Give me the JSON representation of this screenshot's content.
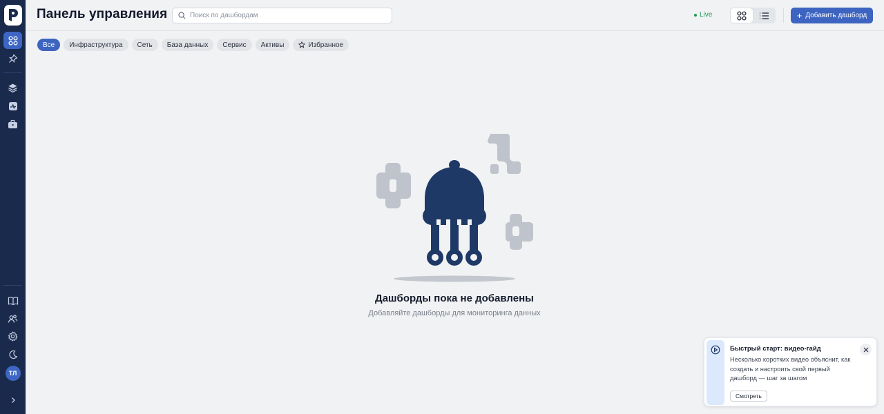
{
  "header": {
    "title": "Панель управления",
    "search_placeholder": "Поиск по дашбордам",
    "live_label": "Live",
    "add_button_label": "Добавить дашборд"
  },
  "sidebar": {
    "logo_icon": "logo-icon",
    "top_items": [
      {
        "icon": "grid-icon",
        "active": true
      },
      {
        "icon": "pin-icon",
        "active": false
      }
    ],
    "middle_items": [
      {
        "icon": "layers-icon"
      },
      {
        "icon": "activity-icon"
      },
      {
        "icon": "briefcase-icon"
      }
    ],
    "bottom_items": [
      {
        "icon": "book-icon"
      },
      {
        "icon": "users-icon"
      },
      {
        "icon": "gear-icon"
      },
      {
        "icon": "moon-icon"
      }
    ],
    "avatar_initials": "ТЛ",
    "expand_icon": "chevron-right-icon"
  },
  "filters": {
    "chips": [
      {
        "label": "Все",
        "active": true
      },
      {
        "label": "Инфраструктура",
        "active": false
      },
      {
        "label": "Сеть",
        "active": false
      },
      {
        "label": "База данных",
        "active": false
      },
      {
        "label": "Сервис",
        "active": false
      },
      {
        "label": "Активы",
        "active": false
      },
      {
        "label": "Избранное",
        "active": false,
        "icon": "star-icon"
      }
    ]
  },
  "empty_state": {
    "title": "Дашборды пока не добавлены",
    "subtitle": "Добавляйте дашборды для мониторинга данных"
  },
  "toast": {
    "title": "Быстрый старт: видео-гайд",
    "body": "Несколько коротких видео объяснит, как создать и настроить свой первый дашборд — шаг за шагом",
    "button_label": "Смотреть"
  },
  "colors": {
    "sidebar_bg": "#1a2a4c",
    "accent": "#3d64c0",
    "live_green": "#1f9a55",
    "illustration_navy": "#1f3966",
    "illustration_gray": "#bfc3cb"
  }
}
